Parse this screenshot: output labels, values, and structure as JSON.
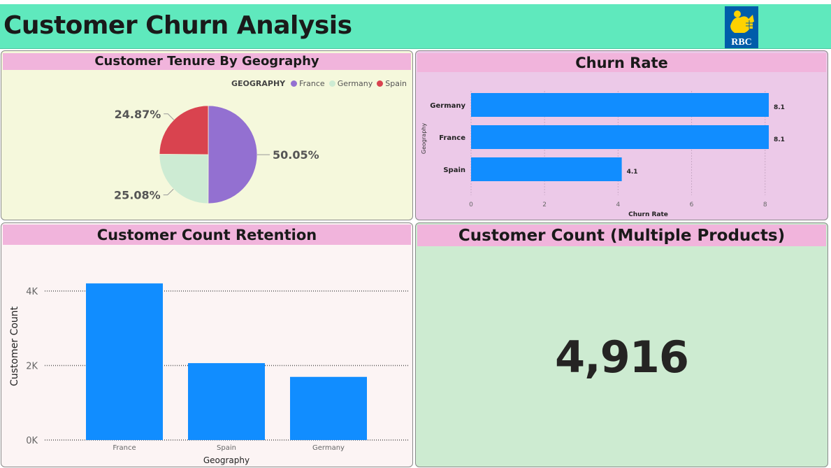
{
  "header": {
    "title": "Customer Churn Analysis",
    "logo_text": "RBC",
    "logo_colors": {
      "blue": "#005daa",
      "gold": "#ffd200"
    }
  },
  "panels": {
    "tenure": {
      "title": "Customer Tenure By Geography"
    },
    "churn": {
      "title": "Churn Rate"
    },
    "retention": {
      "title": "Customer Count Retention"
    },
    "multi": {
      "title": "Customer Count (Multiple Products)",
      "value": "4,916"
    }
  },
  "colors": {
    "bar": "#118dff",
    "france": "#9370d1",
    "germany": "#cdebd3",
    "spain": "#d9434f"
  },
  "chart_data": [
    {
      "type": "pie",
      "legend_title": "GEOGRAPHY",
      "legend_position": "top-right",
      "slices": [
        {
          "label": "France",
          "value": 50.05,
          "display": "50.05%",
          "color": "#9370d1"
        },
        {
          "label": "Germany",
          "value": 25.08,
          "display": "25.08%",
          "color": "#cdebd3"
        },
        {
          "label": "Spain",
          "value": 24.87,
          "display": "24.87%",
          "color": "#d9434f"
        }
      ]
    },
    {
      "type": "bar",
      "orientation": "horizontal",
      "categories": [
        "Germany",
        "France",
        "Spain"
      ],
      "values": [
        8.1,
        8.1,
        4.1
      ],
      "data_labels": [
        "8.1",
        "8.1",
        "4.1"
      ],
      "xlabel": "Churn Rate",
      "ylabel": "Geography",
      "xlim": [
        0,
        8.5
      ],
      "xticks": [
        0,
        2,
        4,
        6,
        8
      ],
      "grid": true
    },
    {
      "type": "bar",
      "categories": [
        "France",
        "Spain",
        "Germany"
      ],
      "values": [
        4204,
        2064,
        1695
      ],
      "xlabel": "Geography",
      "ylabel": "Customer Count",
      "ylim": [
        0,
        4000
      ],
      "yticks": [
        0,
        2000,
        4000
      ],
      "ytick_labels": [
        "0K",
        "2K",
        "4K"
      ],
      "grid": true
    }
  ]
}
